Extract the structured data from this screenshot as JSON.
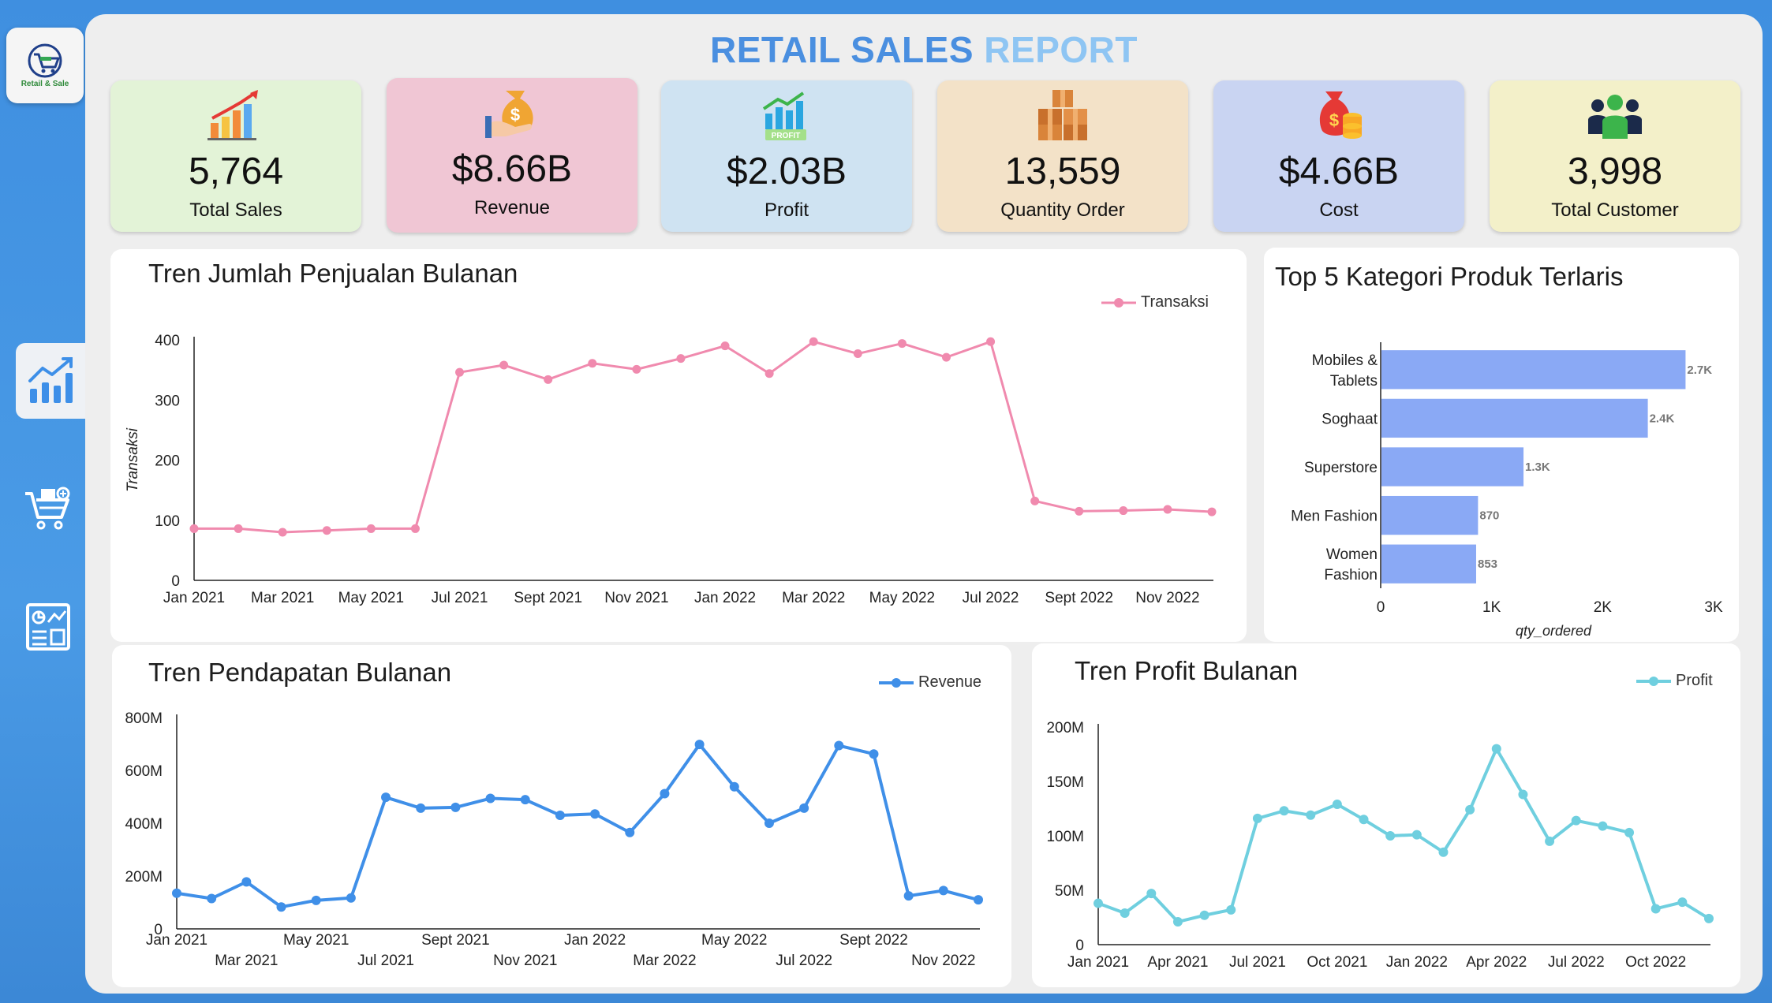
{
  "sidebar": {
    "logo_text": "Retail & Sale",
    "nav": [
      {
        "name": "dashboard",
        "icon": "bar-chart-icon"
      },
      {
        "name": "cart",
        "icon": "shopping-cart-icon"
      },
      {
        "name": "report",
        "icon": "report-icon"
      }
    ]
  },
  "header": {
    "title_part1": "RETAIL SALES",
    "title_part2": "REPORT"
  },
  "kpis": [
    {
      "value": "5,764",
      "label": "Total Sales",
      "icon": "growth-chart-icon",
      "bg": "#e3f3d7"
    },
    {
      "value": "$8.66B",
      "label": "Revenue",
      "icon": "money-bag-icon",
      "bg": "#f0c6d4"
    },
    {
      "value": "$2.03B",
      "label": "Profit",
      "icon": "profit-chart-icon",
      "bg": "#cfe3f2"
    },
    {
      "value": "13,559",
      "label": "Quantity Order",
      "icon": "boxes-icon",
      "bg": "#f3e2c8"
    },
    {
      "value": "$4.66B",
      "label": "Cost",
      "icon": "cost-bag-icon",
      "bg": "#c9d4f2"
    },
    {
      "value": "3,998",
      "label": "Total Customer",
      "icon": "customers-icon",
      "bg": "#f3f0c9"
    }
  ],
  "colors": {
    "transaksi": "#f08aae",
    "revenue": "#3f8fe8",
    "profit": "#6fcfdf",
    "bars": "#8aa9f5"
  },
  "chart_data": [
    {
      "id": "transaksi",
      "type": "line",
      "title": "Tren Jumlah Penjualan Bulanan",
      "ylabel": "Transaksi",
      "xlabel": "",
      "ylim": [
        0,
        400
      ],
      "yticks": [
        "0",
        "100",
        "200",
        "300",
        "400"
      ],
      "xtick_labels": [
        "Jan 2021",
        "Mar 2021",
        "May 2021",
        "Jul 2021",
        "Sept 2021",
        "Nov 2021",
        "Jan 2022",
        "Mar 2022",
        "May 2022",
        "Jul 2022",
        "Sept 2022",
        "Nov 2022"
      ],
      "legend": "top-right",
      "series": [
        {
          "name": "Transaksi",
          "values": [
            86,
            86,
            80,
            83,
            86,
            86,
            346,
            358,
            334,
            361,
            351,
            369,
            390,
            344,
            397,
            377,
            394,
            371,
            397,
            132,
            115,
            116,
            118,
            114
          ]
        }
      ]
    },
    {
      "id": "kategori",
      "type": "bar",
      "orientation": "horizontal",
      "title": "Top 5 Kategori Produk Terlaris",
      "xlabel": "qty_ordered",
      "xlim": [
        0,
        3000
      ],
      "xticks": [
        "0",
        "1K",
        "2K",
        "3K"
      ],
      "categories": [
        [
          "Mobiles &",
          "Tablets"
        ],
        [
          "Soghaat"
        ],
        [
          "Superstore"
        ],
        [
          "Men Fashion"
        ],
        [
          "Women",
          "Fashion"
        ]
      ],
      "values": [
        2740,
        2400,
        1280,
        870,
        853
      ],
      "data_labels": [
        "2.7K",
        "2.4K",
        "1.3K",
        "870",
        "853"
      ]
    },
    {
      "id": "revenue",
      "type": "line",
      "title": "Tren Pendapatan Bulanan",
      "ylim": [
        0,
        800
      ],
      "yticks": [
        "0",
        "200M",
        "400M",
        "600M",
        "800M"
      ],
      "xtick_labels_top": [
        "Jan 2021",
        "May 2021",
        "Sept 2021",
        "Jan 2022",
        "May 2022",
        "Sept 2022"
      ],
      "xtick_labels_bottom": [
        "Mar 2021",
        "Jul 2021",
        "Nov 2021",
        "Mar 2022",
        "Jul 2022",
        "Nov 2022"
      ],
      "legend": "top-right",
      "series": [
        {
          "name": "Revenue",
          "values": [
            135,
            115,
            178,
            83,
            108,
            117,
            498,
            457,
            460,
            494,
            489,
            430,
            435,
            365,
            512,
            698,
            538,
            400,
            457,
            694,
            662,
            125,
            145,
            110
          ]
        }
      ]
    },
    {
      "id": "profit",
      "type": "line",
      "title": "Tren Profit Bulanan",
      "ylim": [
        0,
        200
      ],
      "yticks": [
        "0",
        "50M",
        "100M",
        "150M",
        "200M"
      ],
      "xtick_labels": [
        "Jan 2021",
        "Apr 2021",
        "Jul 2021",
        "Oct 2021",
        "Jan 2022",
        "Apr 2022",
        "Jul 2022",
        "Oct 2022"
      ],
      "legend": "top-right",
      "series": [
        {
          "name": "Profit",
          "values": [
            38,
            29,
            47,
            21,
            27,
            32,
            116,
            123,
            119,
            129,
            115,
            100,
            101,
            85,
            124,
            180,
            138,
            95,
            114,
            109,
            103,
            33,
            39,
            24
          ]
        }
      ]
    }
  ]
}
